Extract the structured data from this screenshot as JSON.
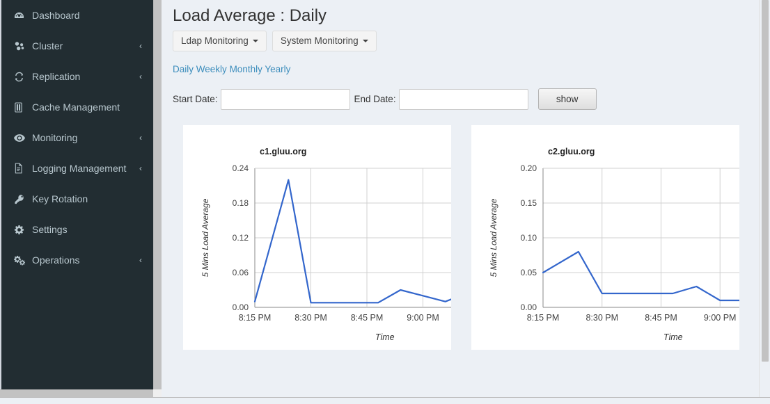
{
  "sidebar": {
    "items": [
      {
        "label": "Dashboard",
        "icon": "dashboard-icon",
        "caret": ""
      },
      {
        "label": "Cluster",
        "icon": "cluster-icon",
        "caret": "‹"
      },
      {
        "label": "Replication",
        "icon": "replication-icon",
        "caret": "‹"
      },
      {
        "label": "Cache Management",
        "icon": "cache-icon",
        "caret": ""
      },
      {
        "label": "Monitoring",
        "icon": "eye-icon",
        "caret": "‹"
      },
      {
        "label": "Logging Management",
        "icon": "file-icon",
        "caret": "‹"
      },
      {
        "label": "Key Rotation",
        "icon": "key-icon",
        "caret": ""
      },
      {
        "label": "Settings",
        "icon": "gear-icon",
        "caret": ""
      },
      {
        "label": "Operations",
        "icon": "gears-icon",
        "caret": "‹"
      }
    ]
  },
  "header": {
    "title": "Load Average : Daily",
    "buttons": [
      {
        "label": "Ldap Monitoring"
      },
      {
        "label": "System Monitoring"
      }
    ],
    "period_links": [
      {
        "label": "Daily"
      },
      {
        "label": "Weekly"
      },
      {
        "label": "Monthly"
      },
      {
        "label": "Yearly"
      }
    ]
  },
  "filters": {
    "start_date_label": "Start Date:",
    "start_date_value": "",
    "start_date_placeholder": "",
    "end_date_label": "End Date:",
    "end_date_value": "",
    "end_date_placeholder": "",
    "show_label": "show"
  },
  "colors": {
    "sidebar_bg": "#222d32",
    "sidebar_text": "#b8c7ce",
    "content_bg": "#ecf0f5",
    "link": "#3c8dbc",
    "series_line": "#3366cc",
    "grid": "#cccccc",
    "axis": "#666666"
  },
  "chart_data": [
    {
      "type": "line",
      "title": "c1.gluu.org",
      "xlabel": "Time",
      "ylabel": "5 Mins Load Average",
      "ylim": [
        0.0,
        0.24
      ],
      "yticks": [
        "0.00",
        "0.06",
        "0.12",
        "0.18",
        "0.24"
      ],
      "ytick_values": [
        0.0,
        0.06,
        0.12,
        0.18,
        0.24
      ],
      "xticks": [
        "8:15 PM",
        "8:30 PM",
        "8:45 PM",
        "9:00 PM"
      ],
      "xtick_minutes": [
        495,
        510,
        525,
        540
      ],
      "xlim_minutes": [
        495,
        555
      ],
      "grid": true,
      "legend": null,
      "clipped_right": true,
      "series": [
        {
          "name": "5 Mins Load Average",
          "color": "#3366cc",
          "x_minutes": [
            495,
            504,
            510,
            516,
            522,
            528,
            534,
            540,
            546,
            552
          ],
          "values": [
            0.01,
            0.22,
            0.008,
            0.008,
            0.008,
            0.008,
            0.03,
            0.02,
            0.01,
            0.025
          ]
        }
      ]
    },
    {
      "type": "line",
      "title": "c2.gluu.org",
      "xlabel": "Time",
      "ylabel": "5 Mins Load Average",
      "ylim": [
        0.0,
        0.2
      ],
      "yticks": [
        "0.00",
        "0.05",
        "0.10",
        "0.15",
        "0.20"
      ],
      "ytick_values": [
        0.0,
        0.05,
        0.1,
        0.15,
        0.2
      ],
      "xticks": [
        "8:15 PM",
        "8:30 PM",
        "8:45 PM",
        "9:00 PM"
      ],
      "xtick_minutes": [
        495,
        510,
        525,
        540
      ],
      "xlim_minutes": [
        495,
        552
      ],
      "grid": true,
      "legend": null,
      "clipped_right": true,
      "series": [
        {
          "name": "5 Mins Load Average",
          "color": "#3366cc",
          "x_minutes": [
            495,
            504,
            510,
            516,
            522,
            528,
            534,
            540,
            546,
            552
          ],
          "values": [
            0.05,
            0.08,
            0.02,
            0.02,
            0.02,
            0.02,
            0.03,
            0.01,
            0.01,
            0.01
          ]
        }
      ]
    }
  ]
}
